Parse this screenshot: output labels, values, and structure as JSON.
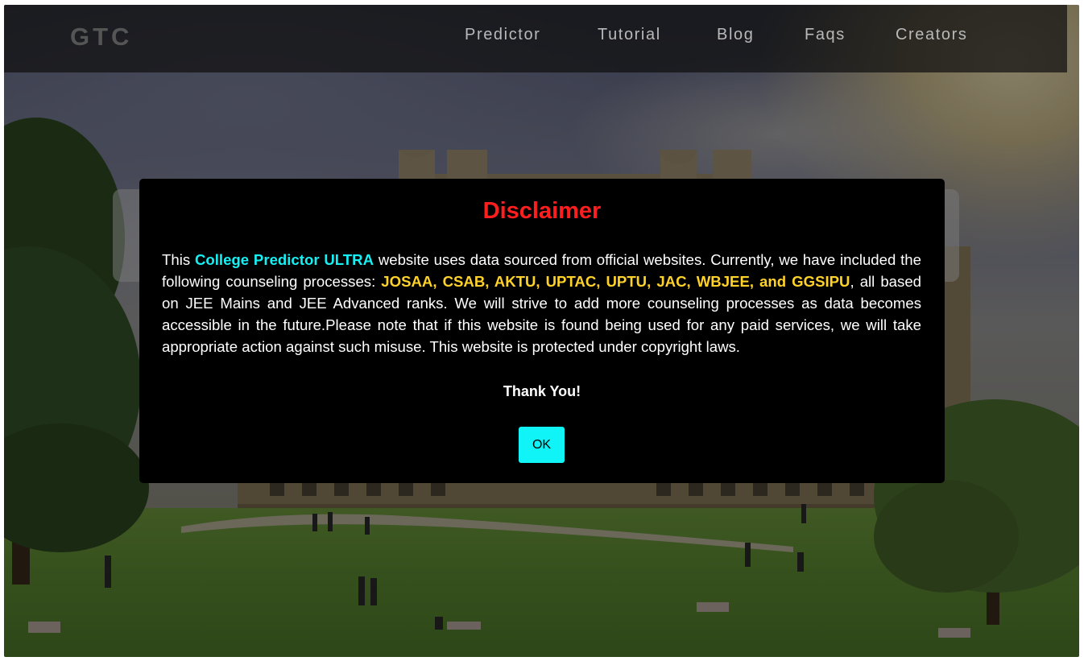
{
  "navbar": {
    "brand": "GTC",
    "links": [
      "Predictor",
      "Tutorial",
      "Blog",
      "Faqs",
      "Creators"
    ]
  },
  "modal": {
    "title": "Disclaimer",
    "body": {
      "p1": "This ",
      "highlight_site": "College Predictor ULTRA",
      "p2": " website uses data sourced from official websites. Currently, we have included the following counseling processes: ",
      "highlight_processes": "JOSAA, CSAB, AKTU, UPTAC, UPTU, JAC, WBJEE, and GGSIPU",
      "p3": ", all based on JEE Mains and JEE Advanced ranks. We will strive to add more counseling processes as data becomes accessible in the future.Please note that if this website is found being used for any paid services, we will take appropriate action against such misuse. This website is protected under copyright laws."
    },
    "thanks": "Thank You!",
    "ok_label": "OK"
  },
  "colors": {
    "title_red": "#ff1e1e",
    "highlight_cyan": "#16f0f4",
    "highlight_gold": "#ffd22a",
    "button_cyan": "#11f4f7"
  }
}
